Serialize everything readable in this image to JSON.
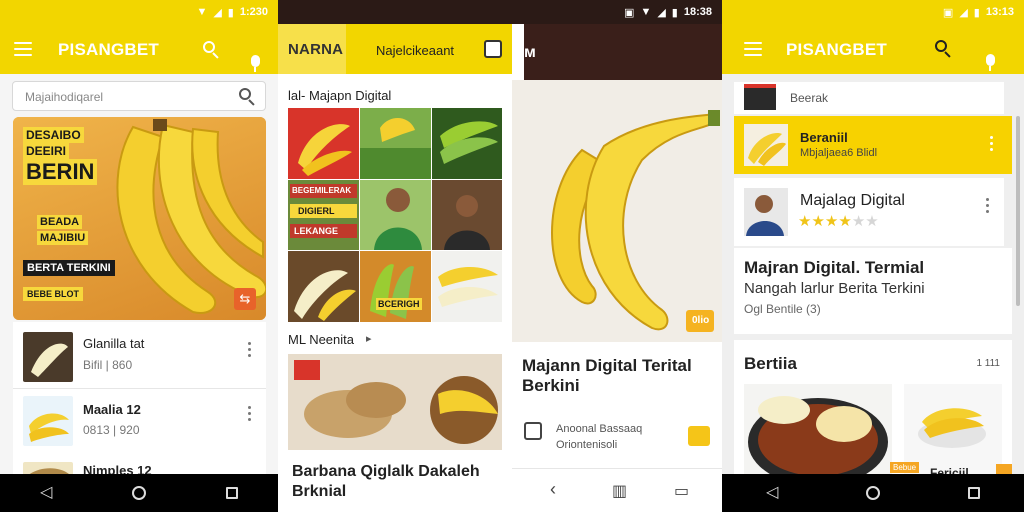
{
  "colors": {
    "accent": "#f2d600",
    "brand_orange": "#f39c12",
    "dark_bar": "#3a1f1a",
    "nav_bar": "#000000"
  },
  "screen1": {
    "status_time": "1:230",
    "app_name": "PISANGBET",
    "search_placeholder": "Majaihodiqarel",
    "hero_poster": {
      "line1": "DESAIBO",
      "line2": "DEEIRI",
      "line3": "BERIN",
      "line4": "BEADA",
      "line5": "MAJIBIU",
      "line6": "BERTA TERKINI",
      "tag": "BEBE BLOT"
    },
    "list": [
      {
        "title": "Glanilla tat",
        "subtitle": "Bifil | 860"
      },
      {
        "title": "Maalia 12",
        "subtitle": "0813 | 920"
      },
      {
        "title": "Nimples 12",
        "subtitle": ""
      }
    ]
  },
  "screen2": {
    "status_time": "18:38",
    "app_name": "NARNA",
    "header_subtitle": "Najelcikeaant",
    "section1": "lal- Majapn Digital",
    "grid_text1": "BEGEMILERAK",
    "grid_text2": "DIGIERL",
    "grid_text3": "LEKANGE",
    "grid_text4": "BCERIGH",
    "section2": "ML Neenita",
    "card_title": "Barbana Qiglalk Dakaleh Brknial"
  },
  "screen2b": {
    "article_title": "Majann Digital Terital Berkini",
    "meta_line1": "Anoonal Bassaaq",
    "meta_line2": "Oriontenisoli",
    "badge": "0lio"
  },
  "screen3": {
    "status_time": "13:13",
    "app_name": "PISANGBET",
    "list": [
      {
        "title": "Beerak",
        "subtitle": ""
      },
      {
        "title": "Beraniil",
        "subtitle": "Mbjaljaea6 Blidl"
      },
      {
        "title": "Majalag Digital",
        "subtitle": "",
        "rating": 3.5
      }
    ],
    "headline": "Majran Digital. Termial",
    "subhead": "Nangah larlur Berita Terkini",
    "meta": "Ogl Bentile (3)",
    "section_title": "Bertiia",
    "section_more": "1 111",
    "bottom_tag": "Fericiil",
    "bottom_badge1": "Bebue"
  }
}
